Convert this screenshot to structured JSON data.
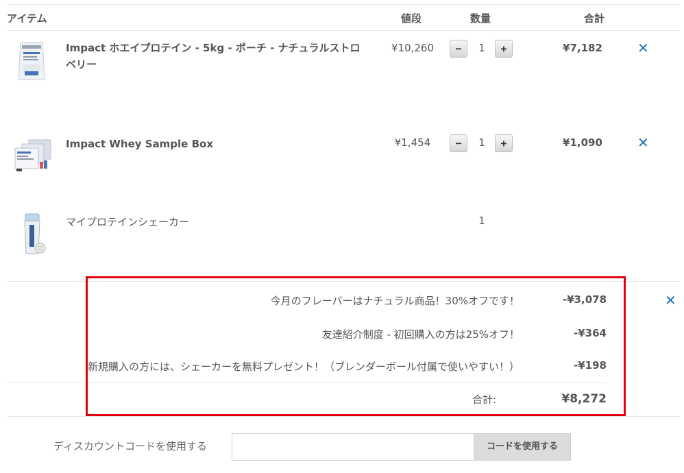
{
  "header": {
    "item_label": "アイテム",
    "price_label": "値段",
    "qty_label": "数量",
    "total_label": "合計"
  },
  "items": [
    {
      "name": "Impact ホエイプロテイン - 5kg - ポーチ - ナチュラルストロベリー",
      "price": "¥10,260",
      "qty": "1",
      "total": "¥7,182",
      "decrease_glyph": "−",
      "increase_glyph": "+",
      "remove_glyph": "✕",
      "image_icon": "protein-pouch-icon"
    },
    {
      "name": "Impact Whey Sample Box",
      "price": "¥1,454",
      "qty": "1",
      "total": "¥1,090",
      "decrease_glyph": "−",
      "increase_glyph": "+",
      "remove_glyph": "✕",
      "image_icon": "sample-box-icon"
    },
    {
      "name": "マイプロテインシェーカー",
      "qty": "1",
      "image_icon": "shaker-bottle-icon"
    }
  ],
  "discounts": [
    {
      "label": "今月のフレーバーはナチュラル商品！30%オフです！",
      "amount": "-¥3,078"
    },
    {
      "label": "友達紹介制度 - 初回購入の方は25%オフ！",
      "amount": "-¥364"
    },
    {
      "label": "新規購入の方には、シェーカーを無料プレゼント！（ブレンダーボール付属で使いやすい！）",
      "amount": "-¥198"
    }
  ],
  "discount_remove_glyph": "✕",
  "summary": {
    "total_label": "合計:",
    "total_value": "¥8,272"
  },
  "discount_code": {
    "label": "ディスカウントコードを使用する",
    "input_value": "",
    "button_label": "コードを使用する"
  },
  "colors": {
    "remove_blue": "#1f6fb5",
    "highlight_red": "#e1000f"
  }
}
